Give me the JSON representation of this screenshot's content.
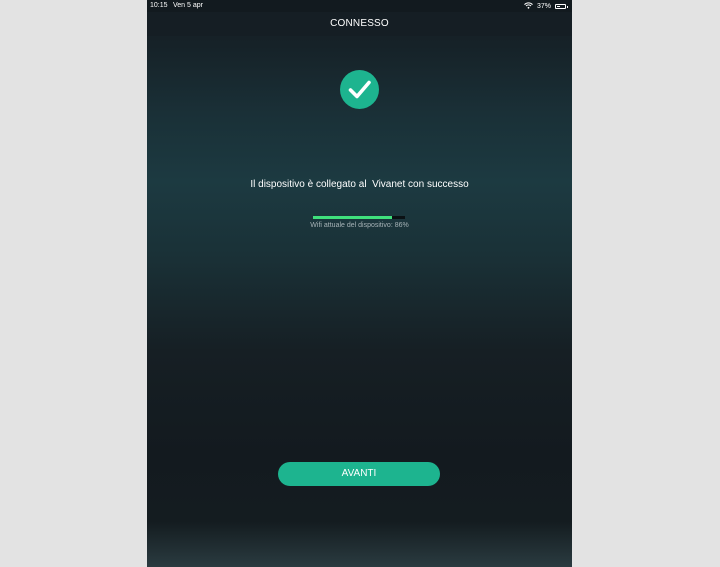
{
  "status_bar": {
    "time": "10:15",
    "date": "Ven 5 apr",
    "battery_percent": "37%",
    "battery_level": 0.37,
    "wifi_icon": "wifi-icon",
    "battery_icon": "battery-icon"
  },
  "nav": {
    "title": "CONNESSO"
  },
  "success": {
    "icon": "checkmark-circle-icon",
    "message": "Il dispositivo è collegato al  Vivanet con successo"
  },
  "wifi": {
    "label": "Wifi attuale del dispositivo: 86%",
    "signal_fraction": 0.86
  },
  "actions": {
    "next_label": "AVANTI"
  },
  "colors": {
    "accent": "#1db48f",
    "signal_bar": "#3fe07c",
    "background_top": "#141c22",
    "background_mid": "#1c3a41"
  }
}
